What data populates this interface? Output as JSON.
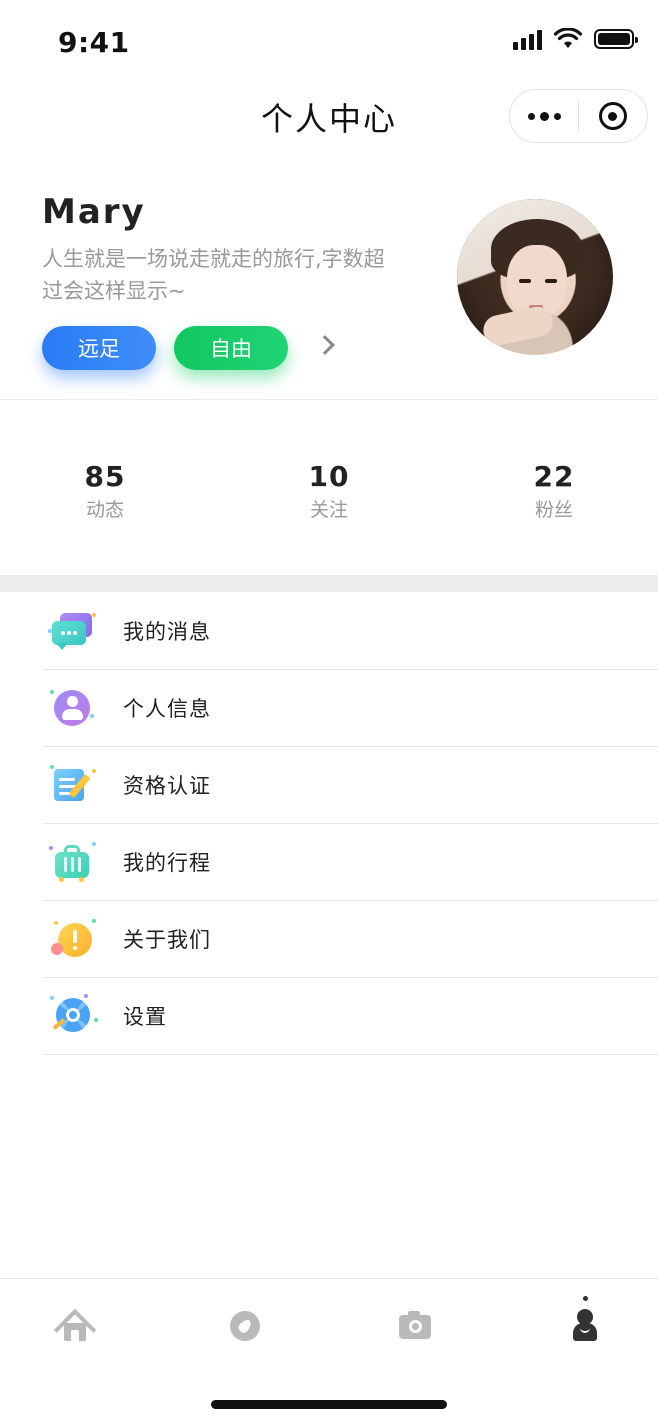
{
  "status_bar": {
    "time": "9:41"
  },
  "nav": {
    "title": "个人中心"
  },
  "profile": {
    "name": "Mary",
    "bio": "人生就是一场说走就走的旅行,字数超过会这样显示~",
    "tags": [
      "远足",
      "自由"
    ]
  },
  "stats": [
    {
      "value": "85",
      "label": "动态"
    },
    {
      "value": "10",
      "label": "关注"
    },
    {
      "value": "22",
      "label": "粉丝"
    }
  ],
  "menu": [
    {
      "label": "我的消息",
      "icon": "message-icon"
    },
    {
      "label": "个人信息",
      "icon": "user-info-icon"
    },
    {
      "label": "资格认证",
      "icon": "certification-icon"
    },
    {
      "label": "我的行程",
      "icon": "luggage-icon"
    },
    {
      "label": "关于我们",
      "icon": "about-icon"
    },
    {
      "label": "设置",
      "icon": "settings-gear-icon"
    }
  ],
  "tabbar": {
    "items": [
      "home-icon",
      "compass-icon",
      "camera-icon",
      "profile-icon"
    ],
    "active": "profile-icon"
  },
  "colors": {
    "accent_blue": "#2a7cf6",
    "accent_green": "#12c660",
    "muted_text": "#999999"
  }
}
